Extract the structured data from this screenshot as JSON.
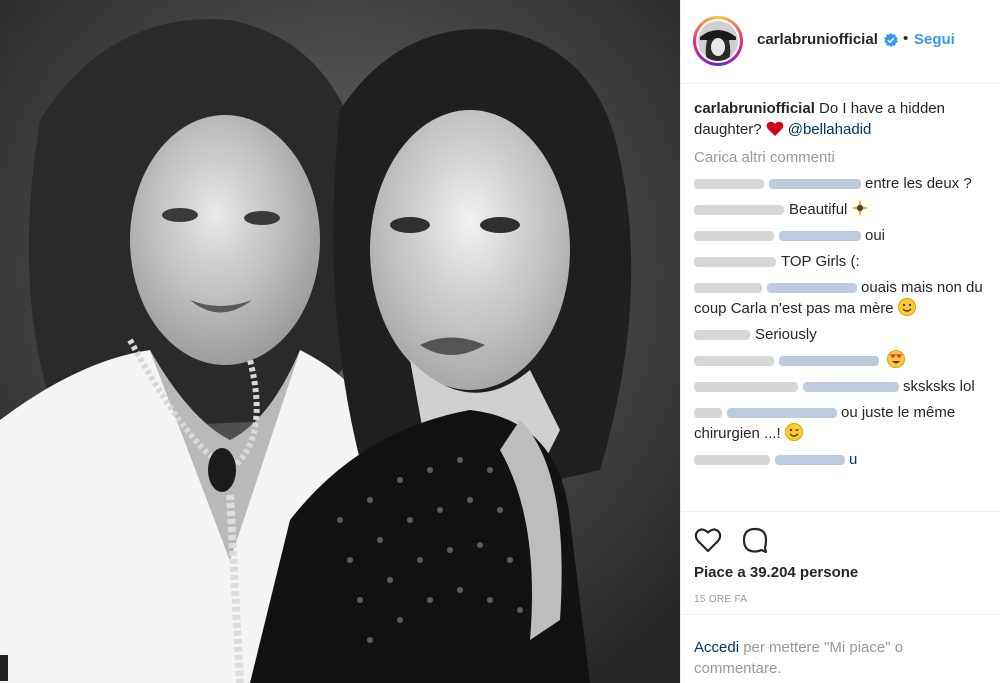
{
  "post": {
    "username": "carlabruniofficial",
    "follow_label": "Segui",
    "separator": "•",
    "caption_user": "carlabruniofficial",
    "caption_text": " Do I have a hidden daughter? ",
    "caption_mention": "@bellahadid",
    "load_more": "Carica altri commenti"
  },
  "comments": [
    {
      "text": "entre les deux ?"
    },
    {
      "text": "Beautiful"
    },
    {
      "text": "oui"
    },
    {
      "text": "TOP Girls (:"
    },
    {
      "text": "ouais mais non du coup Carla n'est pas ma mère"
    },
    {
      "text": "Seriously"
    },
    {
      "text": ""
    },
    {
      "text": "sksksks lol"
    },
    {
      "text": "ou juste le même chirurgien ...!"
    },
    {
      "text": "u"
    }
  ],
  "actions": {
    "likes": "Piace a 39.204 persone",
    "time": "15 ORE FA"
  },
  "login": {
    "link": "Accedi",
    "text": " per mettere \"Mi piace\" o commentare."
  },
  "colors": {
    "accent": "#3897f0",
    "link": "#003569",
    "muted": "#999999",
    "heart": "#ed4956"
  }
}
